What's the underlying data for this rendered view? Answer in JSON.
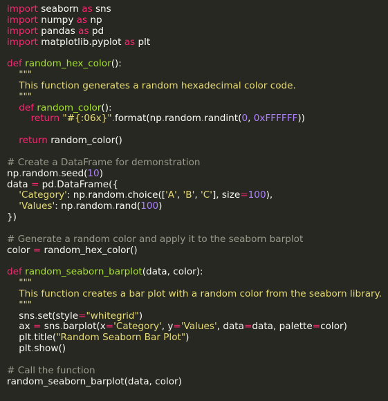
{
  "editor": {
    "lines": [
      [
        {
          "t": "kw",
          "v": "import"
        },
        {
          "t": "pl",
          "v": " seaborn "
        },
        {
          "t": "kw",
          "v": "as"
        },
        {
          "t": "pl",
          "v": " sns"
        }
      ],
      [
        {
          "t": "kw",
          "v": "import"
        },
        {
          "t": "pl",
          "v": " numpy "
        },
        {
          "t": "kw",
          "v": "as"
        },
        {
          "t": "pl",
          "v": " np"
        }
      ],
      [
        {
          "t": "kw",
          "v": "import"
        },
        {
          "t": "pl",
          "v": " pandas "
        },
        {
          "t": "kw",
          "v": "as"
        },
        {
          "t": "pl",
          "v": " pd"
        }
      ],
      [
        {
          "t": "kw",
          "v": "import"
        },
        {
          "t": "pl",
          "v": " matplotlib.pyplot "
        },
        {
          "t": "kw",
          "v": "as"
        },
        {
          "t": "pl",
          "v": " plt"
        }
      ],
      [],
      [
        {
          "t": "kw",
          "v": "def"
        },
        {
          "t": "pl",
          "v": " "
        },
        {
          "t": "fn",
          "v": "random_hex_color"
        },
        {
          "t": "pl",
          "v": "():"
        }
      ],
      [
        {
          "t": "str",
          "v": "    \"\"\""
        }
      ],
      [
        {
          "t": "str",
          "v": "    This function generates a random hexadecimal color code."
        }
      ],
      [
        {
          "t": "str",
          "v": "    \"\"\""
        }
      ],
      [
        {
          "t": "pl",
          "v": "    "
        },
        {
          "t": "kw",
          "v": "def"
        },
        {
          "t": "pl",
          "v": " "
        },
        {
          "t": "fn",
          "v": "random_color"
        },
        {
          "t": "pl",
          "v": "():"
        }
      ],
      [
        {
          "t": "pl",
          "v": "        "
        },
        {
          "t": "kw",
          "v": "return"
        },
        {
          "t": "pl",
          "v": " "
        },
        {
          "t": "str",
          "v": "\"#{:06x}\""
        },
        {
          "t": "dot",
          "v": "."
        },
        {
          "t": "pl",
          "v": "format(np"
        },
        {
          "t": "dot",
          "v": "."
        },
        {
          "t": "pl",
          "v": "random"
        },
        {
          "t": "dot",
          "v": "."
        },
        {
          "t": "pl",
          "v": "randint("
        },
        {
          "t": "num",
          "v": "0"
        },
        {
          "t": "pl",
          "v": ", "
        },
        {
          "t": "num",
          "v": "0xFFFFFF"
        },
        {
          "t": "pl",
          "v": "))"
        }
      ],
      [],
      [
        {
          "t": "pl",
          "v": "    "
        },
        {
          "t": "kw",
          "v": "return"
        },
        {
          "t": "pl",
          "v": " random_color()"
        }
      ],
      [],
      [
        {
          "t": "cm",
          "v": "# Create a DataFrame for demonstration"
        }
      ],
      [
        {
          "t": "pl",
          "v": "np"
        },
        {
          "t": "dot",
          "v": "."
        },
        {
          "t": "pl",
          "v": "random"
        },
        {
          "t": "dot",
          "v": "."
        },
        {
          "t": "pl",
          "v": "seed("
        },
        {
          "t": "num",
          "v": "10"
        },
        {
          "t": "pl",
          "v": ")"
        }
      ],
      [
        {
          "t": "pl",
          "v": "data "
        },
        {
          "t": "kw",
          "v": "="
        },
        {
          "t": "pl",
          "v": " pd"
        },
        {
          "t": "dot",
          "v": "."
        },
        {
          "t": "pl",
          "v": "DataFrame({"
        }
      ],
      [
        {
          "t": "pl",
          "v": "    "
        },
        {
          "t": "str",
          "v": "'Category'"
        },
        {
          "t": "pl",
          "v": ": np"
        },
        {
          "t": "dot",
          "v": "."
        },
        {
          "t": "pl",
          "v": "random"
        },
        {
          "t": "dot",
          "v": "."
        },
        {
          "t": "pl",
          "v": "choice(["
        },
        {
          "t": "str",
          "v": "'A'"
        },
        {
          "t": "pl",
          "v": ", "
        },
        {
          "t": "str",
          "v": "'B'"
        },
        {
          "t": "pl",
          "v": ", "
        },
        {
          "t": "str",
          "v": "'C'"
        },
        {
          "t": "pl",
          "v": "], size"
        },
        {
          "t": "kw",
          "v": "="
        },
        {
          "t": "num",
          "v": "100"
        },
        {
          "t": "pl",
          "v": "),"
        }
      ],
      [
        {
          "t": "pl",
          "v": "    "
        },
        {
          "t": "str",
          "v": "'Values'"
        },
        {
          "t": "pl",
          "v": ": np"
        },
        {
          "t": "dot",
          "v": "."
        },
        {
          "t": "pl",
          "v": "random"
        },
        {
          "t": "dot",
          "v": "."
        },
        {
          "t": "pl",
          "v": "rand("
        },
        {
          "t": "num",
          "v": "100"
        },
        {
          "t": "pl",
          "v": ")"
        }
      ],
      [
        {
          "t": "pl",
          "v": "})"
        }
      ],
      [],
      [
        {
          "t": "cm",
          "v": "# Generate a random color and apply it to the seaborn barplot"
        }
      ],
      [
        {
          "t": "pl",
          "v": "color "
        },
        {
          "t": "kw",
          "v": "="
        },
        {
          "t": "pl",
          "v": " random_hex_color()"
        }
      ],
      [],
      [
        {
          "t": "kw",
          "v": "def"
        },
        {
          "t": "pl",
          "v": " "
        },
        {
          "t": "fn",
          "v": "random_seaborn_barplot"
        },
        {
          "t": "pl",
          "v": "(data, color):"
        }
      ],
      [
        {
          "t": "str",
          "v": "    \"\"\""
        }
      ],
      [
        {
          "t": "str",
          "v": "    This function creates a bar plot with a random color from the seaborn library."
        }
      ],
      [
        {
          "t": "str",
          "v": "    \"\"\""
        }
      ],
      [
        {
          "t": "pl",
          "v": "    sns"
        },
        {
          "t": "dot",
          "v": "."
        },
        {
          "t": "pl",
          "v": "set(style"
        },
        {
          "t": "kw",
          "v": "="
        },
        {
          "t": "str",
          "v": "\"whitegrid\""
        },
        {
          "t": "pl",
          "v": ")"
        }
      ],
      [
        {
          "t": "pl",
          "v": "    ax "
        },
        {
          "t": "kw",
          "v": "="
        },
        {
          "t": "pl",
          "v": " sns"
        },
        {
          "t": "dot",
          "v": "."
        },
        {
          "t": "pl",
          "v": "barplot(x"
        },
        {
          "t": "kw",
          "v": "="
        },
        {
          "t": "str",
          "v": "'Category'"
        },
        {
          "t": "pl",
          "v": ", y"
        },
        {
          "t": "kw",
          "v": "="
        },
        {
          "t": "str",
          "v": "'Values'"
        },
        {
          "t": "pl",
          "v": ", data"
        },
        {
          "t": "kw",
          "v": "="
        },
        {
          "t": "pl",
          "v": "data, palette"
        },
        {
          "t": "kw",
          "v": "="
        },
        {
          "t": "pl",
          "v": "color)"
        }
      ],
      [
        {
          "t": "pl",
          "v": "    plt"
        },
        {
          "t": "dot",
          "v": "."
        },
        {
          "t": "pl",
          "v": "title("
        },
        {
          "t": "str",
          "v": "\"Random Seaborn Bar Plot\""
        },
        {
          "t": "pl",
          "v": ")"
        }
      ],
      [
        {
          "t": "pl",
          "v": "    plt"
        },
        {
          "t": "dot",
          "v": "."
        },
        {
          "t": "pl",
          "v": "show()"
        }
      ],
      [],
      [
        {
          "t": "cm",
          "v": "# Call the function"
        }
      ],
      [
        {
          "t": "pl",
          "v": "random_seaborn_barplot(data, color)"
        }
      ]
    ]
  }
}
